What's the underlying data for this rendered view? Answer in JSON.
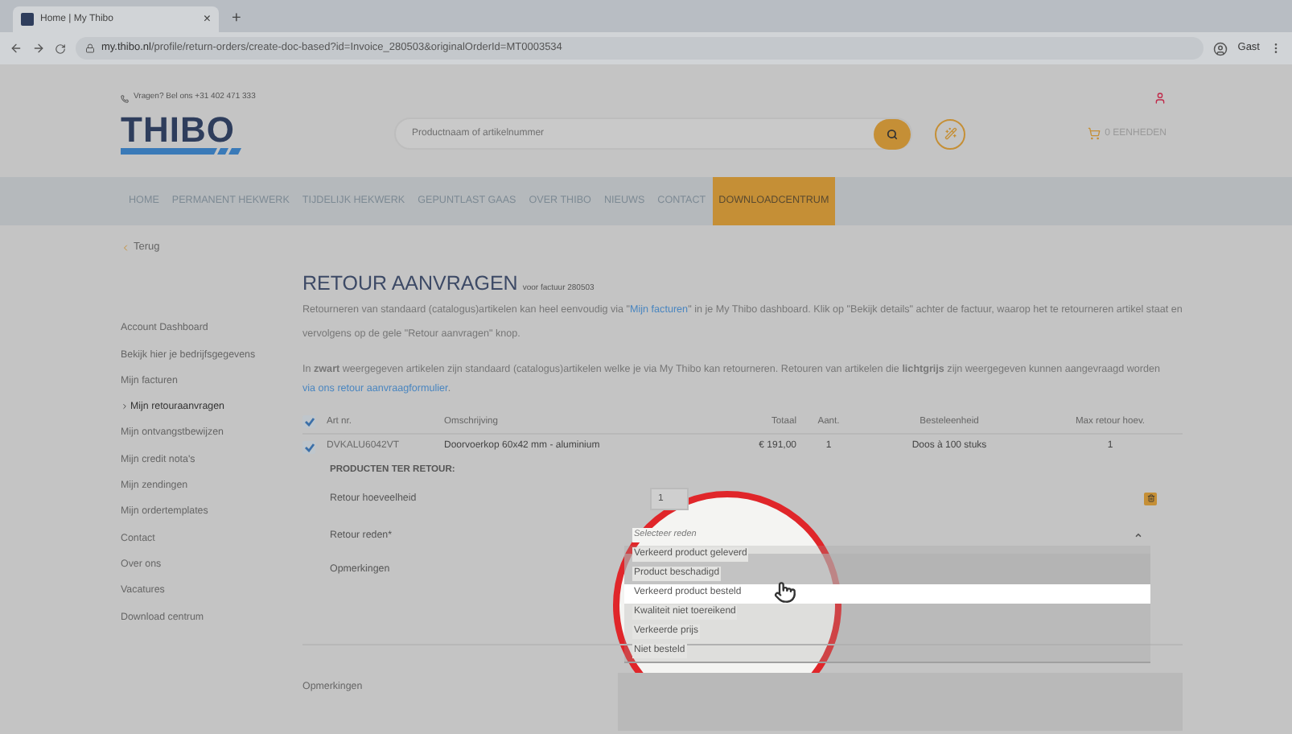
{
  "browser": {
    "tab_title": "Home | My Thibo",
    "tab_close": "×",
    "new_tab": "+",
    "url_host": "my.thibo.nl",
    "url_path": "/profile/return-orders/create-doc-based?id=Invoice_280503&originalOrderId=MT0003534",
    "profile": "Gast"
  },
  "header": {
    "phone": "Vragen? Bel ons +31 402 471 333",
    "logo": "THIBO",
    "search_placeholder": "Productnaam of artikelnummer",
    "cart": "0 EENHEDEN"
  },
  "nav": {
    "items": [
      {
        "label": "HOME",
        "selected": false
      },
      {
        "label": "PERMANENT HEKWERK",
        "selected": false
      },
      {
        "label": "TIJDELIJK HEKWERK",
        "selected": false
      },
      {
        "label": "GEPUNTLAST GAAS",
        "selected": false
      },
      {
        "label": "OVER THIBO",
        "selected": false
      },
      {
        "label": "NIEUWS",
        "selected": false
      },
      {
        "label": "CONTACT",
        "selected": false
      },
      {
        "label": "DOWNLOADCENTRUM",
        "selected": true
      }
    ]
  },
  "back": "Terug",
  "sidebar": {
    "items": [
      {
        "label": "Account Dashboard",
        "selected": false
      },
      {
        "label": "Bekijk hier je bedrijfsgegevens",
        "selected": false
      },
      {
        "label": "Mijn facturen",
        "selected": false
      },
      {
        "label": "Mijn retouraanvragen",
        "selected": true
      },
      {
        "label": "Mijn ontvangstbewijzen",
        "selected": false
      },
      {
        "label": "Mijn credit nota's",
        "selected": false
      },
      {
        "label": "Mijn zendingen",
        "selected": false
      },
      {
        "label": "Mijn ordertemplates",
        "selected": false
      },
      {
        "label": "Contact",
        "selected": false
      },
      {
        "label": "Over ons",
        "selected": false
      },
      {
        "label": "Vacatures",
        "selected": false
      },
      {
        "label": "Download centrum",
        "selected": false
      }
    ]
  },
  "main": {
    "title": "RETOUR AANVRAGEN",
    "subtitle": "voor factuur 280503",
    "intro": {
      "before": "Retourneren van standaard (catalogus)artikelen kan heel eenvoudig via \"",
      "link": "Mijn facturen",
      "after": "\" in je My Thibo dashboard. Klik op \"Bekijk details\" achter de factuur, waarop het te retourneren artikel staat en vervolgens op de gele \"Retour aanvragen\" knop."
    },
    "note": {
      "before": "In **zwart** weergegeven artikelen zijn standaard (catalogus)artikelen welke je via My Thibo kan retourneren. Retouren van artikelen die **lichtgrijs** zijn weergegeven kunnen aangevraagd worden ",
      "link": "via ons retour aanvraagformulier",
      "after": "."
    },
    "table": {
      "header_checked": true,
      "columns": [
        "Art nr.",
        "Omschrijving",
        "Totaal",
        "Aant.",
        "Besteleenheid",
        "Max retour hoev."
      ],
      "rows": [
        {
          "checked": true,
          "cells": [
            "DVKALU6042VT",
            "Doorvoerkop 60x42 mm - aluminium",
            "€ 191,00",
            "1",
            "Doos à 100 stuks",
            "1"
          ]
        }
      ]
    },
    "return_form": {
      "heading": "PRODUCTEN TER RETOUR:",
      "quantity_label": "Retour hoeveelheid",
      "quantity_value": "1",
      "reason_label": "Retour reden*",
      "reason_placeholder": "Selecteer reden",
      "reason_expanded": true,
      "reason_options": [
        {
          "label": "Verkeerd product geleverd",
          "selected": false
        },
        {
          "label": "Product beschadigd",
          "selected": false
        },
        {
          "label": "Verkeerd product besteld",
          "selected": true
        },
        {
          "label": "Kwaliteit niet toereikend",
          "selected": false
        },
        {
          "label": "Verkeerde prijs",
          "selected": false
        },
        {
          "label": "Niet besteld",
          "selected": false
        }
      ],
      "remarks_label": "Opmerkingen"
    },
    "remarks_label": "Opmerkingen"
  }
}
